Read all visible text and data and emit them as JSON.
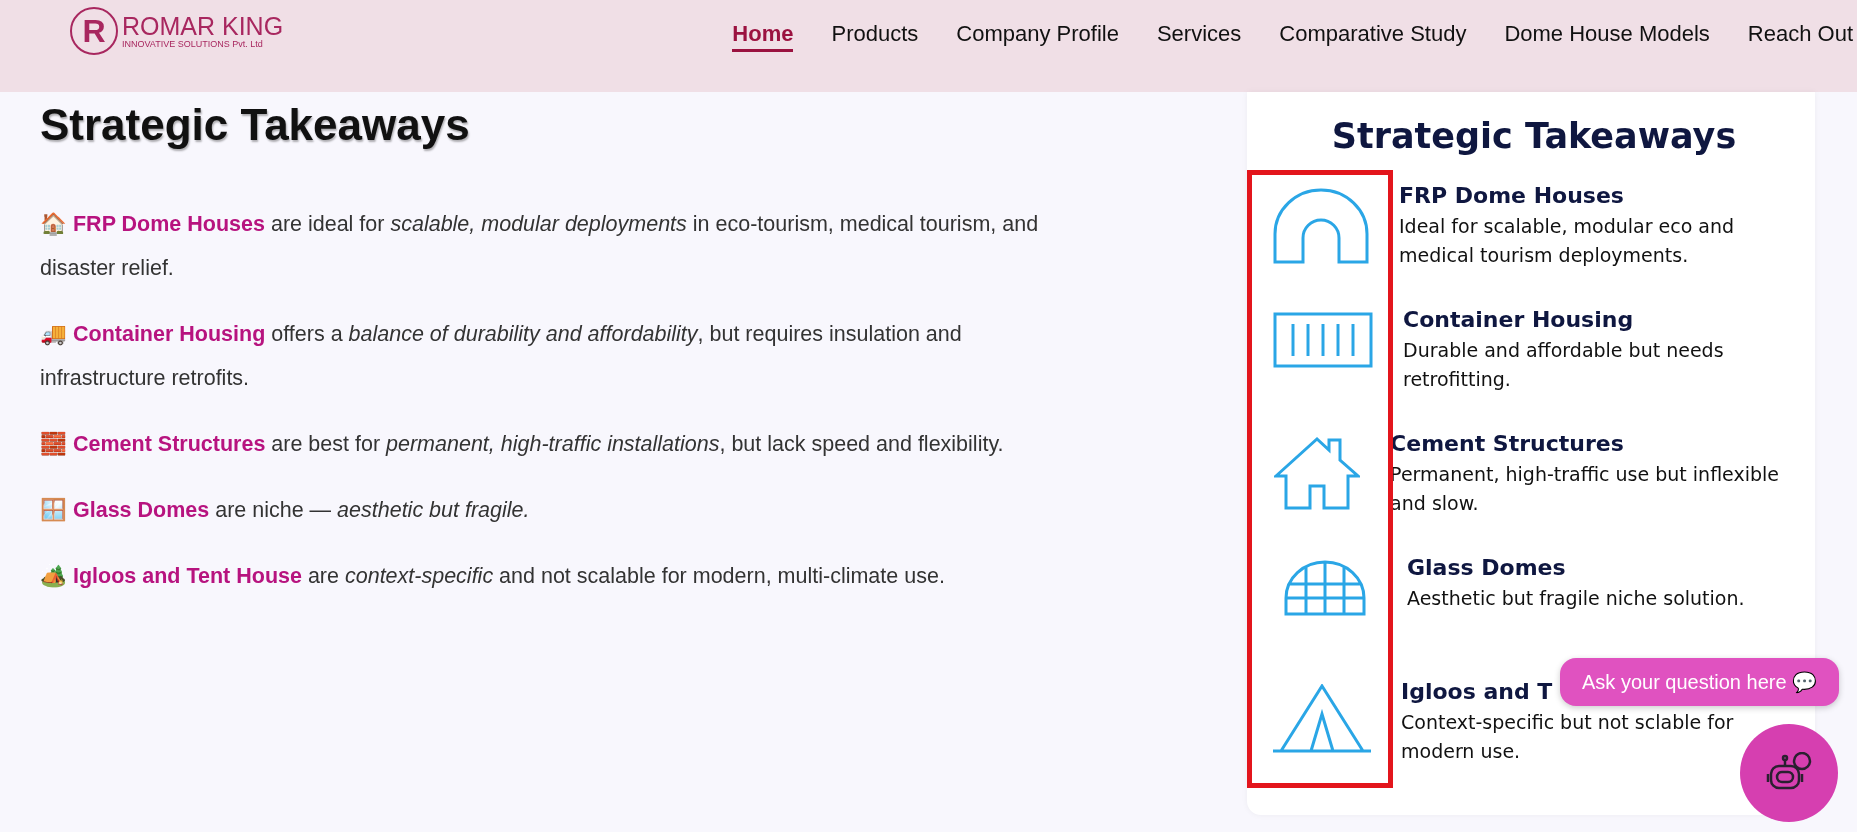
{
  "header": {
    "logo": {
      "mark": "R",
      "name": "ROMAR KING",
      "tagline": "INNOVATIVE SOLUTIONS Pvt. Ltd"
    },
    "nav": [
      {
        "label": "Home",
        "selected": true
      },
      {
        "label": "Products",
        "selected": false
      },
      {
        "label": "Company Profile",
        "selected": false
      },
      {
        "label": "Services",
        "selected": false
      },
      {
        "label": "Comparative Study",
        "selected": false
      },
      {
        "label": "Dome House Models",
        "selected": false
      },
      {
        "label": "Reach Out",
        "selected": false
      }
    ]
  },
  "article": {
    "heading": "Strategic Takeaways",
    "paragraphs": [
      "🏠 **FRP Dome Houses** are ideal for *scalable, modular deployments* in eco-tourism, medical tourism, and disaster relief.",
      "🚚 **Container Housing** offers a *balance of durability and affordability*, but requires insulation and infrastructure retrofits.",
      "🧱 **Cement Structures** are best for *permanent, high-traffic installations*, but lack speed and flexibility.",
      "🪟 **Glass Domes** are niche — *aesthetic but fragile.*",
      "🏕️ **Igloos and Tent House** are *context-specific* and not scalable for modern, multi-climate use."
    ]
  },
  "infographic": {
    "title": "Strategic Takeaways",
    "items": [
      {
        "kind": "arch",
        "title": "FRP Dome Houses",
        "text": "Ideal for scalable, modular eco and medical tourism deployments."
      },
      {
        "kind": "container",
        "title": "Container Housing",
        "text": "Durable and affordable  but needs retrofitting."
      },
      {
        "kind": "house",
        "title": "Cement Structures",
        "text": "Permanent, high-traffic use but inflexible and slow."
      },
      {
        "kind": "dome",
        "title": "Glass Domes",
        "text": "Aesthetic but fragile niche solution."
      },
      {
        "kind": "tent",
        "title": "Igloos and T",
        "text": "Context-specific but not sclable for modern use."
      }
    ]
  },
  "chat": {
    "prompt": "Ask your question here 💬"
  }
}
